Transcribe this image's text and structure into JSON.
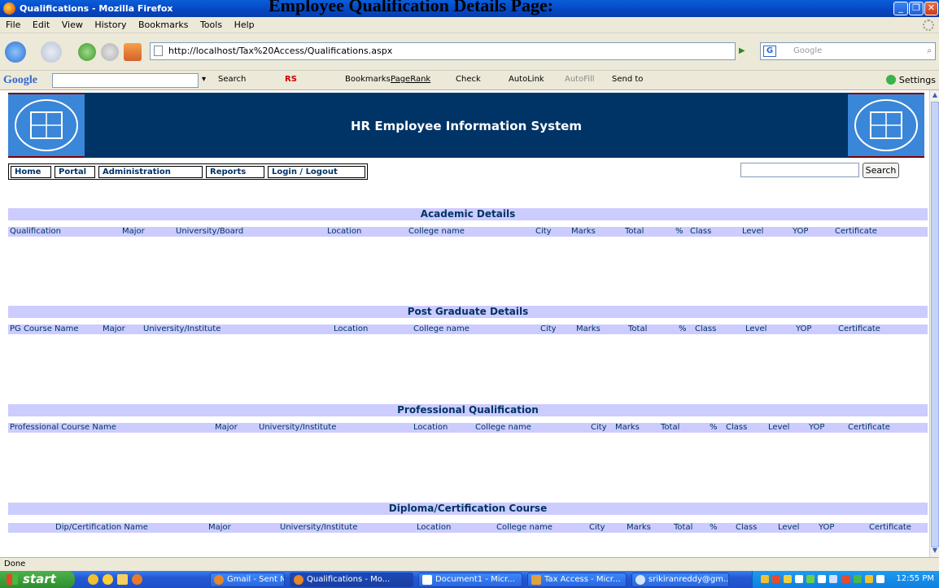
{
  "caption": "Employee Qualification Details Page:",
  "window": {
    "title": "Qualifications - Mozilla Firefox"
  },
  "menu": [
    "File",
    "Edit",
    "View",
    "History",
    "Bookmarks",
    "Tools",
    "Help"
  ],
  "address": {
    "url": "http://localhost/Tax%20Access/Qualifications.aspx",
    "search_placeholder": "Google"
  },
  "google_toolbar": {
    "logo": "Google",
    "search": "Search",
    "rs": "RS",
    "bookmarks": "Bookmarks",
    "pagerank": "PageRank",
    "check": "Check",
    "autolink": "AutoLink",
    "autofill": "AutoFill",
    "sendto": "Send to",
    "settings": "Settings"
  },
  "site": {
    "title": "HR Employee Information System",
    "nav": [
      "Home",
      "Portal",
      "Administration",
      "Reports",
      "Login / Logout"
    ],
    "search_button": "Search"
  },
  "sections": [
    {
      "title": "Academic Details",
      "columns": [
        "Qualification",
        "Major",
        "University/Board",
        "Location",
        "College name",
        "City",
        "Marks",
        "Total",
        "%",
        "Class",
        "Level",
        "YOP",
        "Certificate"
      ]
    },
    {
      "title": "Post Graduate Details",
      "columns": [
        "PG Course Name",
        "Major",
        "University/Institute",
        "Location",
        "College name",
        "City",
        "Marks",
        "Total",
        "%",
        "Class",
        "Level",
        "YOP",
        "Certificate"
      ]
    },
    {
      "title": "Professional Qualification",
      "columns": [
        "Professional Course Name",
        "Major",
        "University/Institute",
        "Location",
        "College name",
        "City",
        "Marks",
        "Total",
        "%",
        "Class",
        "Level",
        "YOP",
        "Certificate"
      ]
    },
    {
      "title": "Diploma/Certification Course",
      "columns": [
        "Dip/Certification Name",
        "Major",
        "University/Institute",
        "Location",
        "College name",
        "City",
        "Marks",
        "Total",
        "%",
        "Class",
        "Level",
        "YOP",
        "Certificate"
      ]
    }
  ],
  "status": "Done",
  "taskbar": {
    "start": "start",
    "tasks": [
      "Gmail - Sent Mail - ...",
      "Qualifications - Mo...",
      "Document1 - Micr...",
      "Tax Access - Micr...",
      "srikiranreddy@gm..."
    ],
    "clock": "12:55 PM"
  }
}
